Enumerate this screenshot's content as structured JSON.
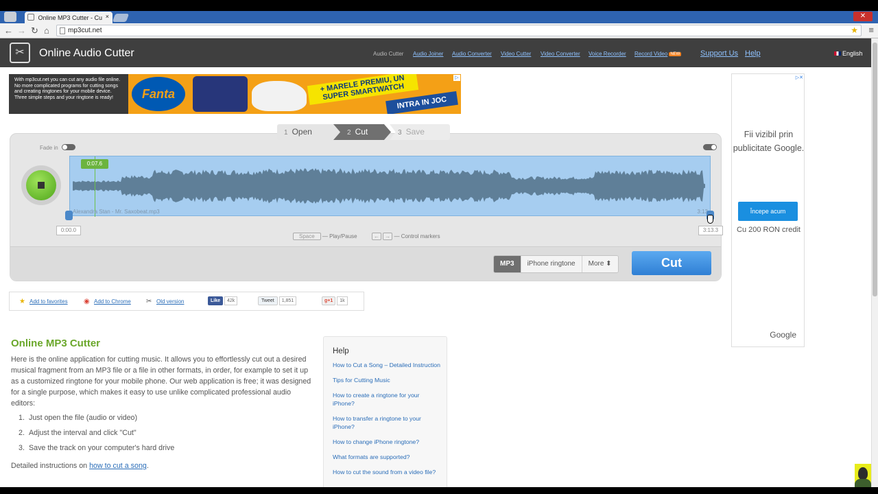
{
  "browser": {
    "tab_title": "Online MP3 Cutter - Cu",
    "tab_close": "×",
    "url": "mp3cut.net",
    "window_close": "✕"
  },
  "header": {
    "brand": "Online Audio Cutter",
    "nav": [
      {
        "label": "Audio Cutter"
      },
      {
        "label": "Audio Joiner"
      },
      {
        "label": "Audio Converter"
      },
      {
        "label": "Video Cutter"
      },
      {
        "label": "Video Converter"
      },
      {
        "label": "Voice Recorder"
      },
      {
        "label": "Record Video"
      }
    ],
    "new_badge": "NEW",
    "support": "Support Us",
    "help": "Help",
    "language": "English"
  },
  "intro_text": "With mp3cut.net you can cut any audio file online. No more complicated programs for cutting songs and creating ringtones for your mobile device. Three simple steps and your ringtone is ready!",
  "banner_ad": {
    "brand": "Fanta",
    "headline": "+ MARELE PREMIU, UN SUPER SMARTWATCH",
    "cta": "INTRA IN JOC"
  },
  "steps": [
    {
      "num": "1",
      "label": "Open"
    },
    {
      "num": "2",
      "label": "Cut"
    },
    {
      "num": "3",
      "label": "Save"
    }
  ],
  "editor": {
    "fade_in": "Fade in",
    "cursor_time": "0:07.6",
    "filename": "Alexandra Stan - Mr. Saxobeat.mp3",
    "end_time_label": "3:13",
    "start_marker": "0:00.0",
    "end_marker": "3:13.3",
    "hint_space_key": "Space",
    "hint_play": "— Play/Pause",
    "hint_arrow_left": "←",
    "hint_arrow_right": "→",
    "hint_control": "— Control markers",
    "formats": {
      "mp3": "MP3",
      "iphone": "iPhone ringtone",
      "more": "More ⬍"
    },
    "cut_button": "Cut",
    "cursor_position_fraction": 0.039
  },
  "social": {
    "favorites": "Add to favorites",
    "chrome": "Add to Chrome",
    "old": "Old version",
    "fb_like": "Like",
    "fb_count": "42k",
    "tweet": "Tweet",
    "tweet_count": "1,851",
    "gplus": "g+1",
    "gplus_count": "1k"
  },
  "content": {
    "title": "Online MP3 Cutter",
    "description": "Here is the online application for cutting music. It allows you to effortlessly cut out a desired musical fragment from an MP3 file or a file in other formats, in order, for example to set it up as a customized ringtone for your mobile phone. Our web application is free; it was designed for a single purpose, which makes it easy to use unlike complicated professional audio editors:",
    "steps": [
      {
        "num": "1.",
        "text": "Just open the file (audio or video)"
      },
      {
        "num": "2.",
        "text": "Adjust the interval and click \"Cut\""
      },
      {
        "num": "3.",
        "text": "Save the track on your computer's hard drive"
      }
    ],
    "detailed_prefix": "Detailed instructions on ",
    "detailed_link": "how to cut a song",
    "detailed_suffix": "."
  },
  "help": {
    "title": "Help",
    "links": [
      "How to Cut a Song – Detailed Instruction",
      "Tips for Cutting Music",
      "How to create a ringtone for your iPhone?",
      "How to transfer a ringtone to your iPhone?",
      "How to change iPhone ringtone?",
      "What formats are supported?",
      "How to cut the sound from a video file?"
    ]
  },
  "side_ad": {
    "text": "Fii vizibil prin publicitate Google.",
    "button": "Începe acum",
    "sub": "Cu 200 RON credit",
    "brand": "Google"
  },
  "colors": {
    "accent_green": "#6aa72a",
    "link_blue": "#2a6db8",
    "cut_blue": "#2f7fd4",
    "waveform_bg": "#a6cdf0"
  }
}
